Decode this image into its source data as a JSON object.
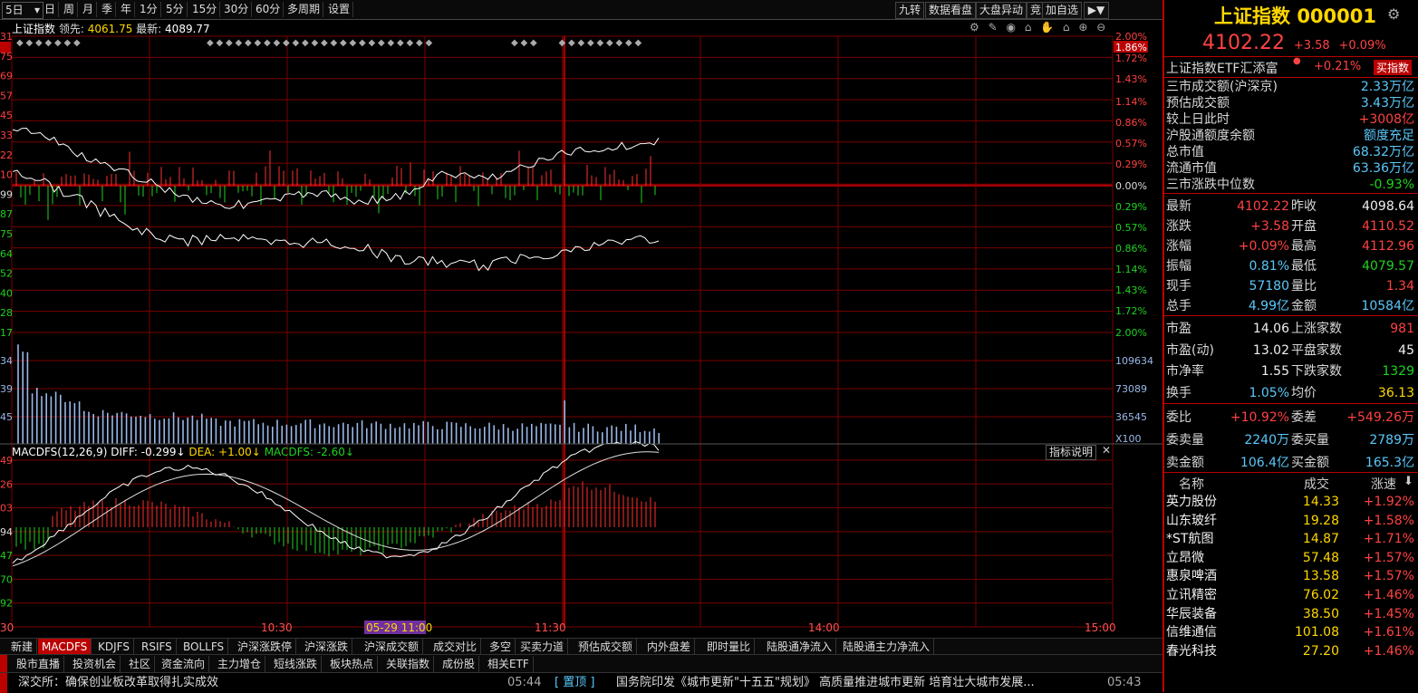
{
  "toolbar": {
    "period_select": "5日",
    "periods": [
      "日",
      "周",
      "月",
      "季",
      "年",
      "1分",
      "5分",
      "15分",
      "30分",
      "60分",
      "多周期",
      "设置"
    ],
    "right_buttons": [
      "九转",
      "数据看盘",
      "大盘异动",
      "竞",
      "加自选"
    ]
  },
  "chart": {
    "index_name": "上证指数",
    "leader_label": "领先:",
    "leader_value": "4061.75",
    "latest_label": "最新:",
    "latest_value": "4089.77",
    "left_axis": [
      "31",
      "75",
      "69",
      "57",
      "45",
      "33",
      "22",
      "10",
      "99",
      "87",
      "75",
      "64",
      "52",
      "40",
      "28",
      "17"
    ],
    "right_pct_up": [
      "2.00%",
      "1.86%",
      "1.72%",
      "1.43%",
      "1.14%",
      "0.86%",
      "0.57%",
      "0.29%",
      "0.00%"
    ],
    "right_pct_down": [
      "0.29%",
      "0.57%",
      "0.86%",
      "1.14%",
      "1.43%",
      "1.72%",
      "2.00%"
    ],
    "vol_left": [
      "34",
      "39",
      "45"
    ],
    "vol_right": [
      "109634",
      "73089",
      "36545",
      "X100"
    ],
    "macd_header": "MACDFS(12,26,9)",
    "diff_text": "DIFF: -0.299↓",
    "dea_text": "DEA: +1.00↓",
    "macdfs_text": "MACDFS: -2.60↓",
    "indicator_help": "指标说明",
    "macd_left": [
      "49",
      "26",
      "03",
      "94",
      "47",
      "70",
      "92"
    ],
    "time_labels": [
      "30",
      "10:30",
      "05-29 11:00",
      "11:30",
      "14:00",
      "15:00"
    ],
    "colors": {
      "up": "#ff3030",
      "down": "#1fd21f",
      "price_line": "#ffffff",
      "grid": "#7a0000",
      "vol": "#9ab8e8"
    }
  },
  "tabs": {
    "row1": [
      "新建",
      "MACDFS",
      "KDJFS",
      "RSIFS",
      "BOLLFS",
      "沪深涨跌停",
      "沪深涨跌",
      "沪深成交额",
      "成交对比",
      "多空",
      "买卖力道",
      "预估成交额",
      "内外盘差",
      "即时量比",
      "陆股通净流入",
      "陆股通主力净流入"
    ],
    "row2": [
      "股市直播",
      "投资机会",
      "社区",
      "资金流向",
      "主力增仓",
      "短线涨跌",
      "板块热点",
      "关联指数",
      "成份股",
      "相关ETF"
    ]
  },
  "ticker": {
    "left_text": "深交所：确保创业板改革取得扎实成效",
    "left_time": "05:44",
    "tag": "[ 置顶 ]",
    "right_text": "国务院印发《城市更新\"十五五\"规划》 高质量推进城市更新 培育壮大城市发展...",
    "right_time": "05:43"
  },
  "quote": {
    "title": "上证指数",
    "code": "000001",
    "price": "4102.22",
    "change": "+3.58",
    "change_pct": "+0.09%",
    "etf_name": "上证指数ETF汇添富",
    "etf_pct": "+0.21%",
    "buy_index": "买指数",
    "stats": [
      {
        "label": "三市成交额(沪深京)",
        "value": "2.33万亿",
        "color": "cyan"
      },
      {
        "label": "预估成交额",
        "value": "3.43万亿",
        "color": "cyan"
      },
      {
        "label": "较上日此时",
        "value": "+3008亿",
        "color": "red"
      },
      {
        "label": "沪股通额度余额",
        "value": "额度充足",
        "color": "cyan"
      },
      {
        "label": "总市值",
        "value": "68.32万亿",
        "color": "cyan"
      },
      {
        "label": "流通市值",
        "value": "63.36万亿",
        "color": "cyan"
      },
      {
        "label": "三市涨跌中位数",
        "value": "-0.93%",
        "color": "green"
      }
    ],
    "grid1": [
      {
        "l1": "最新",
        "v1": "4102.22",
        "c1": "red",
        "l2": "昨收",
        "v2": "4098.64",
        "c2": "white"
      },
      {
        "l1": "涨跌",
        "v1": "+3.58",
        "c1": "red",
        "l2": "开盘",
        "v2": "4110.52",
        "c2": "red"
      },
      {
        "l1": "涨幅",
        "v1": "+0.09%",
        "c1": "red",
        "l2": "最高",
        "v2": "4112.96",
        "c2": "red"
      },
      {
        "l1": "振幅",
        "v1": "0.81%",
        "c1": "cyan",
        "l2": "最低",
        "v2": "4079.57",
        "c2": "green"
      },
      {
        "l1": "现手",
        "v1": "57180",
        "c1": "cyan",
        "l2": "量比",
        "v2": "1.34",
        "c2": "red"
      },
      {
        "l1": "总手",
        "v1": "4.99亿",
        "c1": "cyan",
        "l2": "金额",
        "v2": "10584亿",
        "c2": "cyan"
      }
    ],
    "grid2": [
      {
        "l1": "市盈",
        "v1": "14.06",
        "c1": "white",
        "l2": "上涨家数",
        "v2": "981",
        "c2": "red"
      },
      {
        "l1": "市盈(动)",
        "v1": "13.02",
        "c1": "white",
        "l2": "平盘家数",
        "v2": "45",
        "c2": "white"
      },
      {
        "l1": "市净率",
        "v1": "1.55",
        "c1": "white",
        "l2": "下跌家数",
        "v2": "1329",
        "c2": "green"
      },
      {
        "l1": "换手",
        "v1": "1.05%",
        "c1": "cyan",
        "l2": "均价",
        "v2": "36.13",
        "c2": "yellow"
      }
    ],
    "grid3": [
      {
        "l1": "委比",
        "v1": "+10.92%",
        "c1": "red",
        "l2": "委差",
        "v2": "+549.26万",
        "c2": "red"
      },
      {
        "l1": "委卖量",
        "v1": "2240万",
        "c1": "cyan",
        "l2": "委买量",
        "v2": "2789万",
        "c2": "cyan"
      },
      {
        "l1": "卖金额",
        "v1": "106.4亿",
        "c1": "cyan",
        "l2": "买金额",
        "v2": "165.3亿",
        "c2": "cyan"
      }
    ],
    "list_headers": [
      "名称",
      "成交",
      "涨速"
    ],
    "list": [
      {
        "name": "英力股份",
        "price": "14.33",
        "speed": "+1.92%"
      },
      {
        "name": "山东玻纤",
        "price": "19.28",
        "speed": "+1.58%"
      },
      {
        "name": "*ST航图",
        "price": "14.87",
        "speed": "+1.71%"
      },
      {
        "name": "立昂微",
        "price": "57.48",
        "speed": "+1.57%"
      },
      {
        "name": "惠泉啤酒",
        "price": "13.58",
        "speed": "+1.57%"
      },
      {
        "name": "立讯精密",
        "price": "76.02",
        "speed": "+1.46%"
      },
      {
        "name": "华辰装备",
        "price": "38.50",
        "speed": "+1.45%"
      },
      {
        "name": "信维通信",
        "price": "101.08",
        "speed": "+1.61%"
      },
      {
        "name": "春光科技",
        "price": "27.20",
        "speed": "+1.46%"
      }
    ]
  }
}
